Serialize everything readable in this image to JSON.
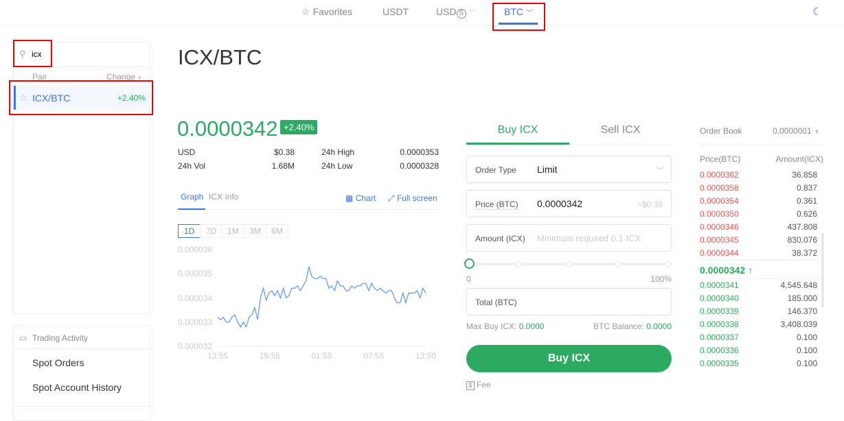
{
  "topnav": {
    "favorites": "Favorites",
    "usdt": "USDT",
    "usds": "USD",
    "usds_symbol": "S",
    "btc": "BTC"
  },
  "sidebar": {
    "search_value": "icx",
    "col_pair": "Pair",
    "col_change": "Change",
    "pairs": [
      {
        "pair": "ICX/BTC",
        "change": "+2.40%"
      }
    ],
    "activity_title": "Trading Activity",
    "links": [
      "Spot Orders",
      "Spot Account History"
    ]
  },
  "market": {
    "title": "ICX/BTC",
    "price": "0.0000342",
    "change_badge": "+2.40%",
    "stats": {
      "usd_label": "USD",
      "usd": "$0.38",
      "vol_label": "24h Vol",
      "vol": "1.68M",
      "high_label": "24h High",
      "high": "0.0000353",
      "low_label": "24h Low",
      "low": "0.0000328"
    },
    "tabs": [
      "Graph",
      "ICX Info"
    ],
    "chart_link": "Chart",
    "fullscreen_link": "Full screen",
    "ranges": [
      "1D",
      "7D",
      "1M",
      "3M",
      "6M"
    ]
  },
  "chart_data": {
    "type": "line",
    "ylim": [
      3.2e-05,
      3.6e-05
    ],
    "yticks": [
      "0.000036",
      "0.000035",
      "0.000034",
      "0.000033",
      "0.000032"
    ],
    "xticks": [
      "13:55",
      "19:55",
      "01:55",
      "07:55",
      "13:50"
    ],
    "series": [
      {
        "name": "ICX/BTC",
        "values_e6": [
          33.2,
          33.1,
          33.2,
          33.0,
          33.0,
          33.2,
          33.3,
          33.0,
          32.8,
          33.0,
          32.8,
          33.2,
          33.3,
          33.6,
          33.1,
          34.0,
          34.4,
          33.9,
          34.2,
          34.3,
          34.1,
          34.3,
          34.0,
          34.4,
          34.0,
          34.1,
          34.4,
          34.4,
          34.5,
          34.3,
          34.5,
          34.7,
          35.3,
          34.9,
          34.8,
          34.8,
          34.9,
          34.8,
          34.8,
          34.4,
          34.5,
          34.3,
          34.7,
          34.5,
          34.5,
          34.3,
          34.3,
          34.5,
          34.4,
          34.5,
          34.5,
          34.6,
          34.6,
          34.3,
          34.6,
          34.4,
          34.3,
          34.4,
          34.3,
          34.2,
          34.3,
          34.3,
          34.0,
          33.8,
          33.8,
          34.2,
          33.8,
          34.2,
          34.2,
          34.2,
          34.3,
          34.0,
          34.4,
          34.2
        ]
      }
    ]
  },
  "trade": {
    "buy_tab": "Buy ICX",
    "sell_tab": "Sell ICX",
    "order_type_label": "Order Type",
    "order_type": "Limit",
    "price_label": "Price (BTC)",
    "price": "0.0000342",
    "price_usd": "≈$0.38",
    "amount_label": "Amount (ICX)",
    "amount_placeholder": "Minimum required 0.1 ICX",
    "slider_min": "0",
    "slider_max": "100%",
    "slider_value": 0,
    "total_label": "Total (BTC)",
    "max_buy_label": "Max Buy ICX:",
    "max_buy": "0.0000",
    "balance_label": "BTC Balance:",
    "balance": "0.0000",
    "buy_button": "Buy ICX",
    "fee": "Fee"
  },
  "orderbook": {
    "title": "Order Book",
    "precision": "0.0000001",
    "col_price": "Price(BTC)",
    "col_amount": "Amount(ICX)",
    "asks": [
      [
        "0.0000362",
        "36.858"
      ],
      [
        "0.0000358",
        "0.837"
      ],
      [
        "0.0000354",
        "0.361"
      ],
      [
        "0.0000350",
        "0.626"
      ],
      [
        "0.0000346",
        "437.808"
      ],
      [
        "0.0000345",
        "830.076"
      ],
      [
        "0.0000344",
        "38.372"
      ]
    ],
    "last": "0.0000342",
    "bids": [
      [
        "0.0000341",
        "4,545.648"
      ],
      [
        "0.0000340",
        "185.000"
      ],
      [
        "0.0000339",
        "146.370"
      ],
      [
        "0.0000338",
        "3,408.039"
      ],
      [
        "0.0000337",
        "0.100"
      ],
      [
        "0.0000336",
        "0.100"
      ],
      [
        "0.0000335",
        "0.100"
      ]
    ]
  },
  "colors": {
    "green": "#2daa62",
    "red": "#e55353",
    "blue": "#3a75e0"
  }
}
